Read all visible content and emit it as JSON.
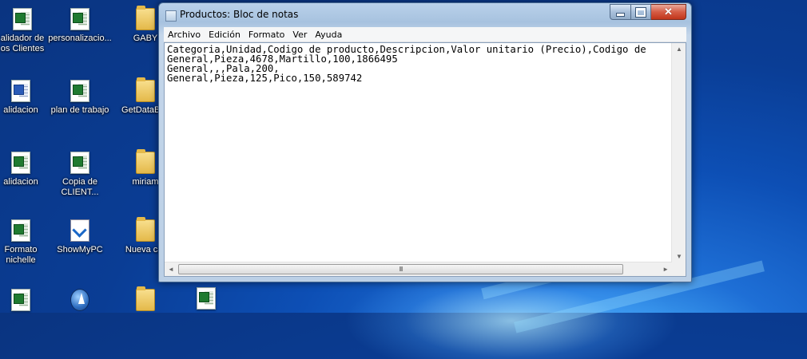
{
  "window": {
    "title": "Productos: Bloc de notas",
    "menu": [
      "Archivo",
      "Edición",
      "Formato",
      "Ver",
      "Ayuda"
    ],
    "lines": [
      "Categoria,Unidad,Codigo de producto,Descripcion,Valor unitario (Precio),Codigo de",
      "General,Pieza,4678,Martillo,100,1866495",
      "General,,,Pala,200,",
      "General,Pieza,125,Pico,150,589742"
    ],
    "scroll_glyphs": {
      "up": "▲",
      "down": "▼",
      "left": "◄",
      "right": "►",
      "grip": "III"
    }
  },
  "desktop": {
    "icons": [
      {
        "label": "alidador de\nos Clientes",
        "icon": "excel-file-icon"
      },
      {
        "label": "personalizacio...",
        "icon": "excel-file-icon"
      },
      {
        "label": "GABY",
        "icon": "folder-icon"
      },
      {
        "label": "alidacion",
        "icon": "word-file-icon"
      },
      {
        "label": "plan de trabajo",
        "icon": "excel-file-icon"
      },
      {
        "label": "GetDataBac",
        "icon": "folder-icon"
      },
      {
        "label": "alidacion",
        "icon": "excel-file-icon"
      },
      {
        "label": "Copia de\nCLIENT...",
        "icon": "excel-file-icon"
      },
      {
        "label": "miriam",
        "icon": "folder-icon"
      },
      {
        "label": "Formato\nnichelle",
        "icon": "excel-file-icon"
      },
      {
        "label": "ShowMyPC",
        "icon": "app-shortcut-icon"
      },
      {
        "label": "Nueva car",
        "icon": "folder-icon"
      }
    ]
  }
}
